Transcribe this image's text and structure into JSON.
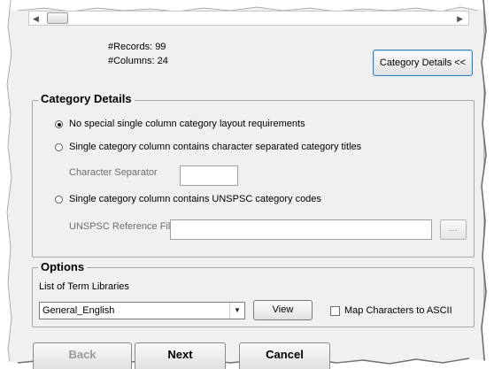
{
  "info": {
    "records": "#Records: 99",
    "columns": "#Columns: 24"
  },
  "buttons": {
    "category_details": "Category Details <<",
    "view": "View",
    "browse": "...",
    "back": "Back",
    "next": "Next",
    "cancel": "Cancel"
  },
  "category_details": {
    "title": "Category Details",
    "options": [
      {
        "label": "No special single column category layout requirements",
        "selected": true
      },
      {
        "label": "Single category column contains character separated category titles",
        "selected": false
      },
      {
        "label": "Single category column contains UNSPSC category codes",
        "selected": false
      }
    ],
    "character_separator_label": "Character Separator",
    "character_separator_value": "",
    "unspsc_file_label": "UNSPSC Reference File",
    "unspsc_file_value": ""
  },
  "options": {
    "title": "Options",
    "term_libraries_label": "List of Term Libraries",
    "term_library_selected": "General_English",
    "map_ascii_label": "Map Characters to ASCII",
    "map_ascii_checked": false
  }
}
